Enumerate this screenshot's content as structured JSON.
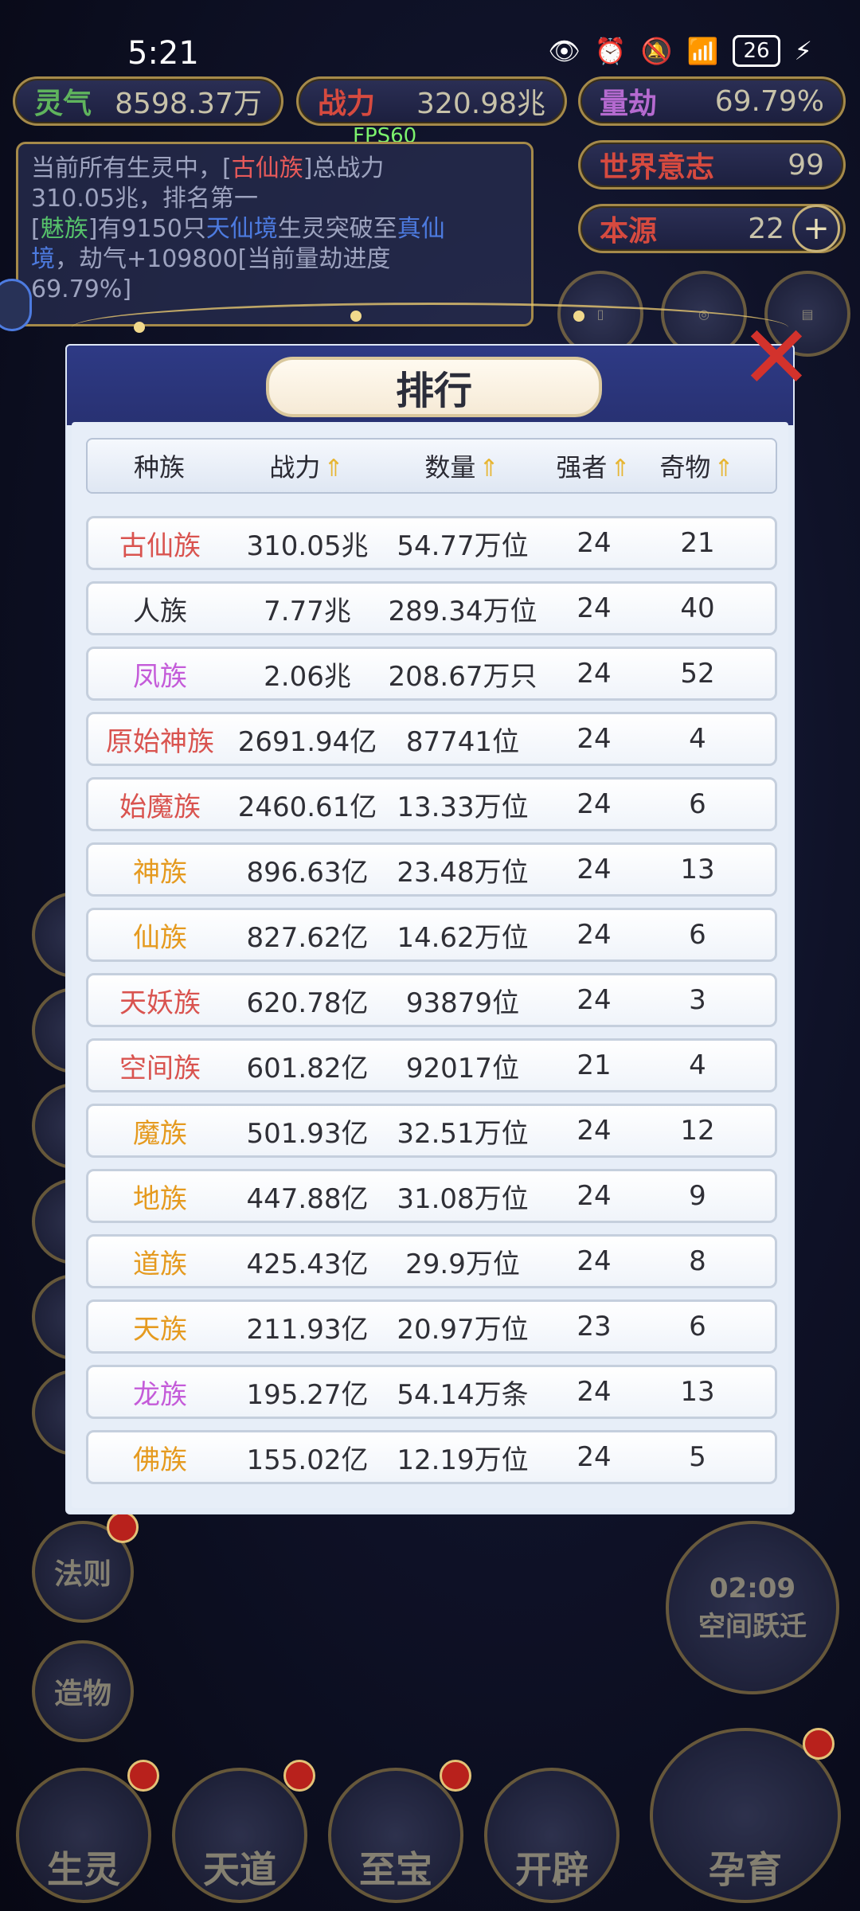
{
  "status_bar": {
    "time": "5:21",
    "battery": "26"
  },
  "resources": {
    "lingqi": {
      "label": "灵气",
      "value": "8598.37万"
    },
    "zhanli": {
      "label": "战力",
      "value": "320.98兆"
    },
    "liangjie": {
      "label": "量劫",
      "value": "69.79%"
    },
    "shijie": {
      "label": "世界意志",
      "value": "99"
    },
    "benyuan": {
      "label": "本源",
      "value": "22"
    }
  },
  "fps": "FPS60",
  "message": {
    "line1_prefix": "当前所有生灵中，[",
    "line1_race": "古仙族",
    "line1_suffix": "]总战力",
    "line2": "310.05兆，排名第一",
    "line3_race": "魅族",
    "line3_mid": "有9150只",
    "line3_realm": "天仙境",
    "line3_tail": "生灵突破至",
    "line3_target": "真仙",
    "line4_prefix": "境",
    "line4_suffix": "，劫气+109800[当前量劫进度",
    "line5": "69.79%]"
  },
  "modal": {
    "title": "排行",
    "close": "✕",
    "headers": {
      "race": "种族",
      "power": "战力",
      "count": "数量",
      "strong": "强者",
      "rare": "奇物"
    },
    "sort_glyph": "⇑",
    "rows": [
      {
        "race": "古仙族",
        "color": "#d9534f",
        "power": "310.05兆",
        "count": "54.77万位",
        "strong": "24",
        "rare": "21"
      },
      {
        "race": "人族",
        "color": "#2f2f36",
        "power": "7.77兆",
        "count": "289.34万位",
        "strong": "24",
        "rare": "40"
      },
      {
        "race": "凤族",
        "color": "#c45bd9",
        "power": "2.06兆",
        "count": "208.67万只",
        "strong": "24",
        "rare": "52"
      },
      {
        "race": "原始神族",
        "color": "#d9534f",
        "power": "2691.94亿",
        "count": "87741位",
        "strong": "24",
        "rare": "4"
      },
      {
        "race": "始魔族",
        "color": "#d9534f",
        "power": "2460.61亿",
        "count": "13.33万位",
        "strong": "24",
        "rare": "6"
      },
      {
        "race": "神族",
        "color": "#e59a1f",
        "power": "896.63亿",
        "count": "23.48万位",
        "strong": "24",
        "rare": "13"
      },
      {
        "race": "仙族",
        "color": "#e59a1f",
        "power": "827.62亿",
        "count": "14.62万位",
        "strong": "24",
        "rare": "6"
      },
      {
        "race": "天妖族",
        "color": "#d9534f",
        "power": "620.78亿",
        "count": "93879位",
        "strong": "24",
        "rare": "3"
      },
      {
        "race": "空间族",
        "color": "#d9534f",
        "power": "601.82亿",
        "count": "92017位",
        "strong": "21",
        "rare": "4"
      },
      {
        "race": "魔族",
        "color": "#e59a1f",
        "power": "501.93亿",
        "count": "32.51万位",
        "strong": "24",
        "rare": "12"
      },
      {
        "race": "地族",
        "color": "#e59a1f",
        "power": "447.88亿",
        "count": "31.08万位",
        "strong": "24",
        "rare": "9"
      },
      {
        "race": "道族",
        "color": "#e59a1f",
        "power": "425.43亿",
        "count": "29.9万位",
        "strong": "24",
        "rare": "8"
      },
      {
        "race": "天族",
        "color": "#e59a1f",
        "power": "211.93亿",
        "count": "20.97万位",
        "strong": "23",
        "rare": "6"
      },
      {
        "race": "龙族",
        "color": "#c45bd9",
        "power": "195.27亿",
        "count": "54.14万条",
        "strong": "24",
        "rare": "13"
      },
      {
        "race": "佛族",
        "color": "#e59a1f",
        "power": "155.02亿",
        "count": "12.19万位",
        "strong": "24",
        "rare": "5"
      }
    ]
  },
  "side_buttons": {
    "fazhe": "法则",
    "zaowu": "造物"
  },
  "right_widget": {
    "timer": "02:09",
    "label": "空间跃迁"
  },
  "bottom_nav": [
    {
      "label": "生灵"
    },
    {
      "label": "天道"
    },
    {
      "label": "至宝"
    },
    {
      "label": "开辟"
    },
    {
      "label": "孕育"
    }
  ]
}
